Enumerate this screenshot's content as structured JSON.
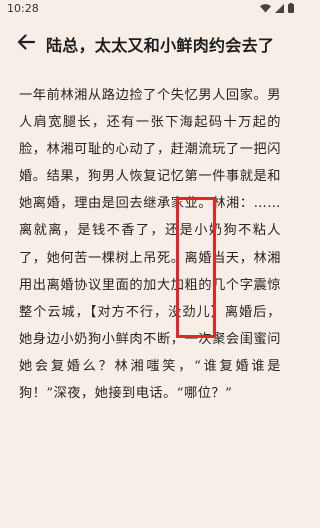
{
  "status_bar": {
    "time": "10:28",
    "icons": [
      "wifi-icon",
      "signal-icon",
      "battery-icon"
    ]
  },
  "header": {
    "back_icon": "arrow-left-icon",
    "title": "陆总，太太又和小鲜肉约会去了"
  },
  "article": {
    "paragraph": "一年前林湘从路边捡了个失忆男人回家。男人肩宽腿长，还有一张下海起码十万起的脸，林湘可耻的心动了，赶潮流玩了一把闪婚。结果，狗男人恢复记忆第一件事就是和她离婚，理由是回去继承家业。林湘：……离就离，是钱不香了，还是小奶狗不粘人了，她何苦一棵树上吊死。离婚当天，林湘用出离婚协议里面的加大加粗的几个字震惊整个云城，【对方不行，没劲儿】离婚后，她身边小奶狗小鲜肉不断，一次聚会闺蜜问她会复婚么？林湘嗤笑，“谁复婚谁是狗！”深夜，她接到电话。“哪位？”"
  },
  "annotation": {
    "color": "#e8242a"
  },
  "colors": {
    "background": "#f7eee7",
    "text": "#2b2320"
  }
}
